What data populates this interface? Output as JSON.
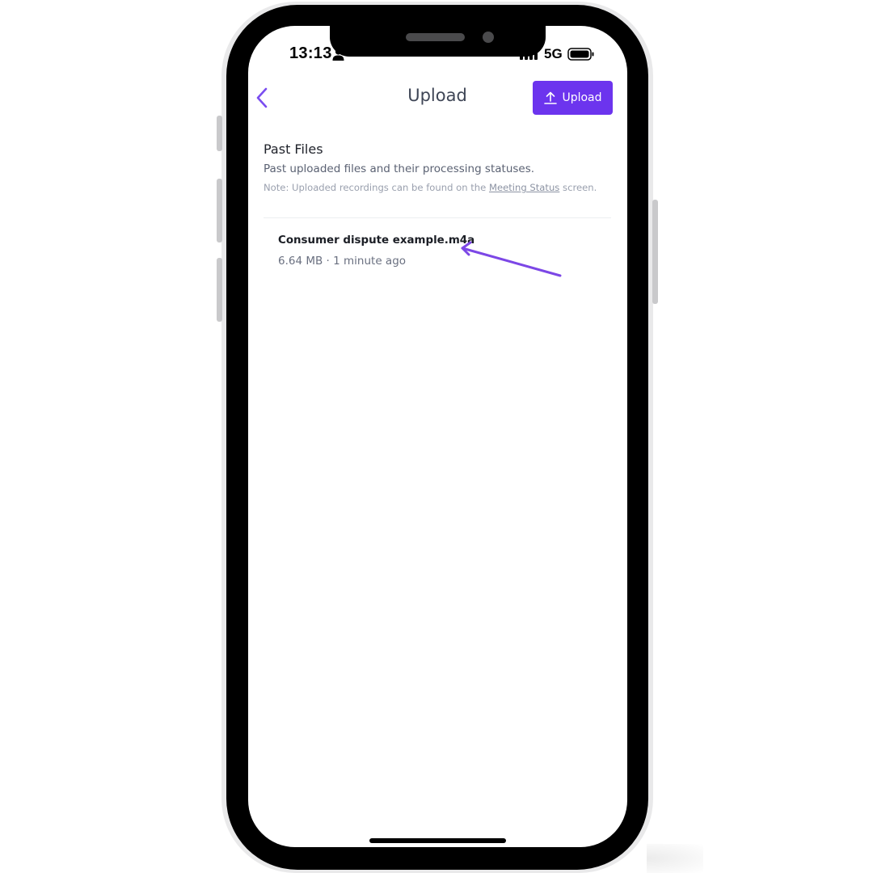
{
  "status_bar": {
    "time": "13:13",
    "network": "5G",
    "icons": [
      "person-icon",
      "signal-icon",
      "battery-icon"
    ]
  },
  "header": {
    "title": "Upload",
    "upload_button_label": "Upload",
    "back_icon": "chevron-left-icon",
    "upload_icon": "upload-arrow-icon"
  },
  "past_files": {
    "title": "Past Files",
    "description": "Past uploaded files and their processing statuses.",
    "note_prefix": "Note: Uploaded recordings can be found on the ",
    "note_link": "Meeting Status",
    "note_suffix": " screen."
  },
  "files": [
    {
      "name": "Consumer dispute example.m4a",
      "meta": "6.64 MB · 1 minute ago"
    }
  ],
  "colors": {
    "accent": "#6c34ee",
    "back_icon": "#7a4df0",
    "annotation_arrow": "#7c47e6",
    "title_text": "#3f4656"
  }
}
